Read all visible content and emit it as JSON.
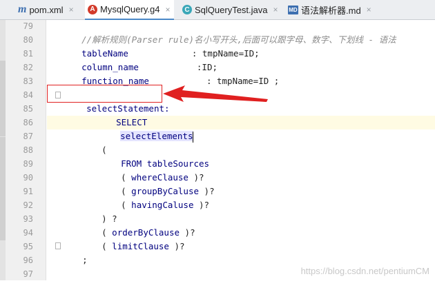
{
  "tabs": [
    {
      "label": "pom.xml",
      "icon": "maven-icon",
      "icon_text": "m",
      "active": false
    },
    {
      "label": "MysqlQuery.g4",
      "icon": "antlr-icon",
      "icon_text": "A",
      "active": true
    },
    {
      "label": "SqlQueryTest.java",
      "icon": "java-class-icon",
      "icon_text": "C",
      "active": false
    },
    {
      "label": "语法解析器.md",
      "icon": "markdown-icon",
      "icon_text": "MD",
      "active": false
    }
  ],
  "close_glyph": "×",
  "line_numbers": [
    "79",
    "80",
    "81",
    "82",
    "83",
    "84",
    "85",
    "86",
    "87",
    "88",
    "89",
    "90",
    "91",
    "92",
    "93",
    "94",
    "95",
    "96",
    "97"
  ],
  "code": {
    "l79": "//解析规则(Parser rule)名小写开头,后面可以跟字母、数字、下划线 - 语法",
    "l80_a": "tableName",
    "l80_b": ": tmpName=ID;",
    "l81_a": "column_name",
    "l81_b": ":ID;",
    "l82_a": "function_name",
    "l82_b": ": tmpName=ID ;",
    "l84": "selectStatement:",
    "l85": "SELECT",
    "l86": "selectElements",
    "l87": "(",
    "l88_a": "FROM",
    "l88_b": "tableSources",
    "l89_a": "( ",
    "l89_b": "whereClause",
    "l89_c": " )?",
    "l90_a": "( ",
    "l90_b": "groupByCaluse",
    "l90_c": " )?",
    "l91_a": "( ",
    "l91_b": "havingCaluse",
    "l91_c": " )?",
    "l92": ") ?",
    "l93_a": "( ",
    "l93_b": "orderByClause",
    "l93_c": " )?",
    "l94_a": "( ",
    "l94_b": "limitClause",
    "l94_c": " )?",
    "l95": ";"
  },
  "watermark": "https://blog.csdn.net/pentiumCM",
  "colors": {
    "keyword": "#00007f",
    "annotation_red": "#e02020",
    "caret_line": "#fffbe3",
    "active_tab_underline": "#4a88c7"
  }
}
